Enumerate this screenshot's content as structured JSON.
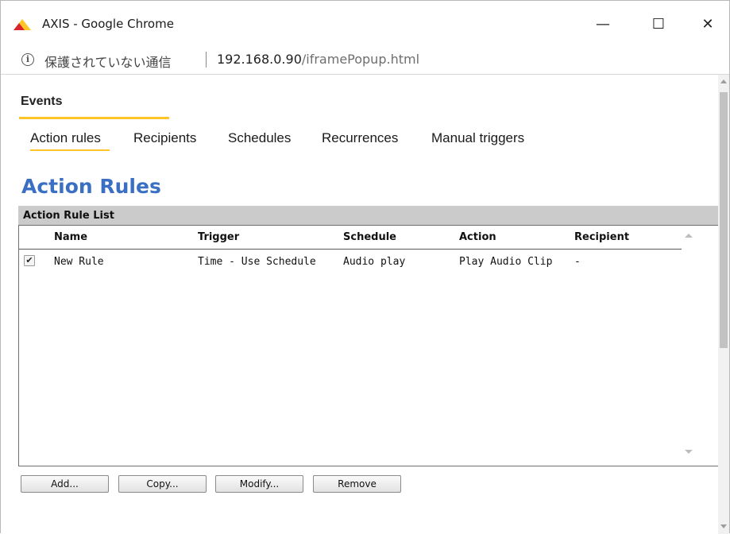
{
  "window": {
    "title": "AXIS - Google Chrome",
    "minimize_glyph": "—",
    "maximize_glyph": "☐",
    "close_glyph": "✕",
    "brand_colors": {
      "red": "#d9232e",
      "yellow": "#ffc526"
    }
  },
  "address_bar": {
    "info_glyph": "i",
    "security_label": "保護されていない通信",
    "url_host": "192.168.0.90",
    "url_path": "/iframePopup.html"
  },
  "page": {
    "section_title": "Events",
    "subnav": [
      {
        "label": "Action rules",
        "active": true
      },
      {
        "label": "Recipients"
      },
      {
        "label": "Schedules"
      },
      {
        "label": "Recurrences"
      },
      {
        "label": "Manual triggers"
      }
    ],
    "heading": "Action Rules",
    "heading_color": "#3a6fc4",
    "list": {
      "title": "Action Rule List",
      "columns": [
        "Name",
        "Trigger",
        "Schedule",
        "Action",
        "Recipient"
      ],
      "rows": [
        {
          "checked": true,
          "check_glyph": "✔",
          "name": "New Rule",
          "trigger": "Time - Use Schedule",
          "schedule": "Audio play",
          "action": "Play Audio Clip",
          "recipient": "-"
        }
      ]
    },
    "buttons": {
      "add": "Add...",
      "copy": "Copy...",
      "modify": "Modify...",
      "remove": "Remove"
    }
  }
}
